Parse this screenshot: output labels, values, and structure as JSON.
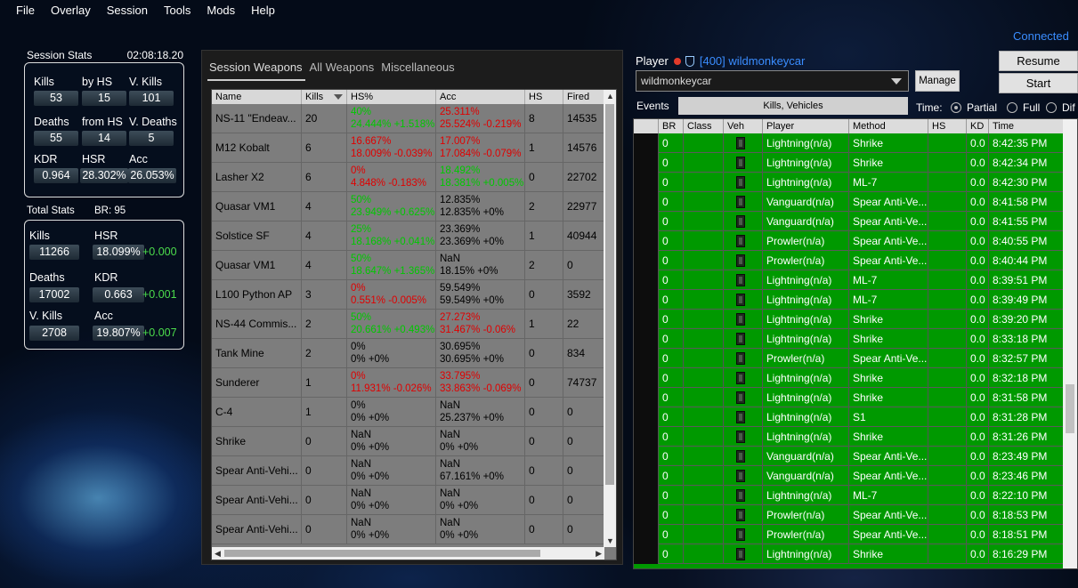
{
  "menu": [
    "File",
    "Overlay",
    "Session",
    "Tools",
    "Mods",
    "Help"
  ],
  "session": {
    "title": "Session Stats",
    "time": "02:08:18.20",
    "labels": {
      "kills": "Kills",
      "by_hs": "by HS",
      "v_kills": "V. Kills",
      "deaths": "Deaths",
      "from_hs": "from HS",
      "v_deaths": "V. Deaths",
      "kdr": "KDR",
      "hsr": "HSR",
      "acc": "Acc"
    },
    "values": {
      "kills": "53",
      "by_hs": "15",
      "v_kills": "101",
      "deaths": "55",
      "from_hs": "14",
      "v_deaths": "5",
      "kdr": "0.964",
      "hsr": "28.302%",
      "acc": "26.053%"
    }
  },
  "total": {
    "title": "Total Stats",
    "br": "BR: 95",
    "labels": {
      "kills": "Kills",
      "hsr": "HSR",
      "deaths": "Deaths",
      "kdr": "KDR",
      "v_kills": "V. Kills",
      "acc": "Acc"
    },
    "values": {
      "kills": "11266",
      "hsr": "18.099%",
      "deaths": "17002",
      "kdr": "0.663",
      "v_kills": "2708",
      "acc": "19.807%"
    },
    "deltas": {
      "hsr": "+0.000",
      "kdr": "+0.001",
      "acc": "+0.007"
    }
  },
  "weapons": {
    "tabs": [
      "Session Weapons",
      "All Weapons",
      "Miscellaneous"
    ],
    "columns": [
      "Name",
      "Kills",
      "HS%",
      "Acc",
      "HS",
      "Fired"
    ],
    "rows": [
      {
        "name": "NS-11 \"Endeav...",
        "kills": "20",
        "hs1": "40%",
        "hs1c": "g",
        "hs2": "24.444% +1.518%",
        "hs2c": "g",
        "acc1": "25.311%",
        "acc1c": "r",
        "acc2": "25.524% -0.219%",
        "acc2c": "r",
        "hs": "8",
        "fired": "14535"
      },
      {
        "name": "M12 Kobalt",
        "kills": "6",
        "hs1": "16.667%",
        "hs1c": "r",
        "hs2": "18.009% -0.039%",
        "hs2c": "r",
        "acc1": "17.007%",
        "acc1c": "r",
        "acc2": "17.084% -0.079%",
        "acc2c": "r",
        "hs": "1",
        "fired": "14576"
      },
      {
        "name": "Lasher X2",
        "kills": "6",
        "hs1": "0%",
        "hs1c": "r",
        "hs2": "4.848% -0.183%",
        "hs2c": "r",
        "acc1": "18.492%",
        "acc1c": "g",
        "acc2": "18.381% +0.005%",
        "acc2c": "g",
        "hs": "0",
        "fired": "22702"
      },
      {
        "name": "Quasar VM1",
        "kills": "4",
        "hs1": "50%",
        "hs1c": "g",
        "hs2": "23.949% +0.625%",
        "hs2c": "g",
        "acc1": "12.835%",
        "acc1c": "",
        "acc2": "12.835% +0%",
        "acc2c": "",
        "hs": "2",
        "fired": "22977"
      },
      {
        "name": "Solstice SF",
        "kills": "4",
        "hs1": "25%",
        "hs1c": "g",
        "hs2": "18.168% +0.041%",
        "hs2c": "g",
        "acc1": "23.369%",
        "acc1c": "",
        "acc2": "23.369% +0%",
        "acc2c": "",
        "hs": "1",
        "fired": "40944"
      },
      {
        "name": "Quasar VM1",
        "kills": "4",
        "hs1": "50%",
        "hs1c": "g",
        "hs2": "18.647% +1.365%",
        "hs2c": "g",
        "acc1": "NaN",
        "acc1c": "",
        "acc2": "18.15% +0%",
        "acc2c": "",
        "hs": "2",
        "fired": "0"
      },
      {
        "name": "L100 Python AP",
        "kills": "3",
        "hs1": "0%",
        "hs1c": "r",
        "hs2": "0.551% -0.005%",
        "hs2c": "r",
        "acc1": "59.549%",
        "acc1c": "",
        "acc2": "59.549% +0%",
        "acc2c": "",
        "hs": "0",
        "fired": "3592"
      },
      {
        "name": "NS-44 Commis...",
        "kills": "2",
        "hs1": "50%",
        "hs1c": "g",
        "hs2": "20.661% +0.493%",
        "hs2c": "g",
        "acc1": "27.273%",
        "acc1c": "r",
        "acc2": "31.467% -0.06%",
        "acc2c": "r",
        "hs": "1",
        "fired": "22"
      },
      {
        "name": "Tank Mine",
        "kills": "2",
        "hs1": "0%",
        "hs1c": "",
        "hs2": "0% +0%",
        "hs2c": "",
        "acc1": "30.695%",
        "acc1c": "",
        "acc2": "30.695% +0%",
        "acc2c": "",
        "hs": "0",
        "fired": "834"
      },
      {
        "name": "Sunderer",
        "kills": "1",
        "hs1": "0%",
        "hs1c": "r",
        "hs2": "11.931% -0.026%",
        "hs2c": "r",
        "acc1": "33.795%",
        "acc1c": "r",
        "acc2": "33.863% -0.069%",
        "acc2c": "r",
        "hs": "0",
        "fired": "74737"
      },
      {
        "name": "C-4",
        "kills": "1",
        "hs1": "0%",
        "hs1c": "",
        "hs2": "0% +0%",
        "hs2c": "",
        "acc1": "NaN",
        "acc1c": "",
        "acc2": "25.237% +0%",
        "acc2c": "",
        "hs": "0",
        "fired": "0"
      },
      {
        "name": "Shrike",
        "kills": "0",
        "hs1": "NaN",
        "hs1c": "",
        "hs2": "0% +0%",
        "hs2c": "",
        "acc1": "NaN",
        "acc1c": "",
        "acc2": "0% +0%",
        "acc2c": "",
        "hs": "0",
        "fired": "0"
      },
      {
        "name": "Spear Anti-Vehi...",
        "kills": "0",
        "hs1": "NaN",
        "hs1c": "",
        "hs2": "0% +0%",
        "hs2c": "",
        "acc1": "NaN",
        "acc1c": "",
        "acc2": "67.161% +0%",
        "acc2c": "",
        "hs": "0",
        "fired": "0"
      },
      {
        "name": "Spear Anti-Vehi...",
        "kills": "0",
        "hs1": "NaN",
        "hs1c": "",
        "hs2": "0% +0%",
        "hs2c": "",
        "acc1": "NaN",
        "acc1c": "",
        "acc2": "0% +0%",
        "acc2c": "",
        "hs": "0",
        "fired": "0"
      },
      {
        "name": "Spear Anti-Vehi...",
        "kills": "0",
        "hs1": "NaN",
        "hs1c": "",
        "hs2": "0% +0%",
        "hs2c": "",
        "acc1": "NaN",
        "acc1c": "",
        "acc2": "0% +0%",
        "acc2c": "",
        "hs": "0",
        "fired": "0"
      }
    ]
  },
  "right": {
    "connected": "Connected",
    "resume": "Resume",
    "start": "Start",
    "player_label": "Player",
    "player_link": "[400] wildmonkeycar",
    "player_value": "wildmonkeycar",
    "manage": "Manage",
    "events_label": "Events",
    "filter": "Kills, Vehicles",
    "time_label": "Time:",
    "time_options": [
      "Partial",
      "Full",
      "Dif"
    ],
    "columns": [
      "BR",
      "Class",
      "Veh",
      "Player",
      "Method",
      "HS",
      "KD",
      "Time"
    ],
    "rows": [
      {
        "br": "0",
        "player": "Lightning(n/a)",
        "method": "Shrike",
        "kd": "0.0",
        "time": "8:42:35 PM"
      },
      {
        "br": "0",
        "player": "Lightning(n/a)",
        "method": "Shrike",
        "kd": "0.0",
        "time": "8:42:34 PM"
      },
      {
        "br": "0",
        "player": "Lightning(n/a)",
        "method": "ML-7",
        "kd": "0.0",
        "time": "8:42:30 PM"
      },
      {
        "br": "0",
        "player": "Vanguard(n/a)",
        "method": "Spear Anti-Ve...",
        "kd": "0.0",
        "time": "8:41:58 PM"
      },
      {
        "br": "0",
        "player": "Vanguard(n/a)",
        "method": "Spear Anti-Ve...",
        "kd": "0.0",
        "time": "8:41:55 PM"
      },
      {
        "br": "0",
        "player": "Prowler(n/a)",
        "method": "Spear Anti-Ve...",
        "kd": "0.0",
        "time": "8:40:55 PM"
      },
      {
        "br": "0",
        "player": "Prowler(n/a)",
        "method": "Spear Anti-Ve...",
        "kd": "0.0",
        "time": "8:40:44 PM"
      },
      {
        "br": "0",
        "player": "Lightning(n/a)",
        "method": "ML-7",
        "kd": "0.0",
        "time": "8:39:51 PM"
      },
      {
        "br": "0",
        "player": "Lightning(n/a)",
        "method": "ML-7",
        "kd": "0.0",
        "time": "8:39:49 PM"
      },
      {
        "br": "0",
        "player": "Lightning(n/a)",
        "method": "Shrike",
        "kd": "0.0",
        "time": "8:39:20 PM"
      },
      {
        "br": "0",
        "player": "Lightning(n/a)",
        "method": "Shrike",
        "kd": "0.0",
        "time": "8:33:18 PM"
      },
      {
        "br": "0",
        "player": "Prowler(n/a)",
        "method": "Spear Anti-Ve...",
        "kd": "0.0",
        "time": "8:32:57 PM"
      },
      {
        "br": "0",
        "player": "Lightning(n/a)",
        "method": "Shrike",
        "kd": "0.0",
        "time": "8:32:18 PM"
      },
      {
        "br": "0",
        "player": "Lightning(n/a)",
        "method": "Shrike",
        "kd": "0.0",
        "time": "8:31:58 PM"
      },
      {
        "br": "0",
        "player": "Lightning(n/a)",
        "method": "S1",
        "kd": "0.0",
        "time": "8:31:28 PM"
      },
      {
        "br": "0",
        "player": "Lightning(n/a)",
        "method": "Shrike",
        "kd": "0.0",
        "time": "8:31:26 PM"
      },
      {
        "br": "0",
        "player": "Vanguard(n/a)",
        "method": "Spear Anti-Ve...",
        "kd": "0.0",
        "time": "8:23:49 PM"
      },
      {
        "br": "0",
        "player": "Vanguard(n/a)",
        "method": "Spear Anti-Ve...",
        "kd": "0.0",
        "time": "8:23:46 PM"
      },
      {
        "br": "0",
        "player": "Lightning(n/a)",
        "method": "ML-7",
        "kd": "0.0",
        "time": "8:22:10 PM"
      },
      {
        "br": "0",
        "player": "Prowler(n/a)",
        "method": "Spear Anti-Ve...",
        "kd": "0.0",
        "time": "8:18:53 PM"
      },
      {
        "br": "0",
        "player": "Prowler(n/a)",
        "method": "Spear Anti-Ve...",
        "kd": "0.0",
        "time": "8:18:51 PM"
      },
      {
        "br": "0",
        "player": "Lightning(n/a)",
        "method": "Shrike",
        "kd": "0.0",
        "time": "8:16:29 PM"
      }
    ]
  }
}
